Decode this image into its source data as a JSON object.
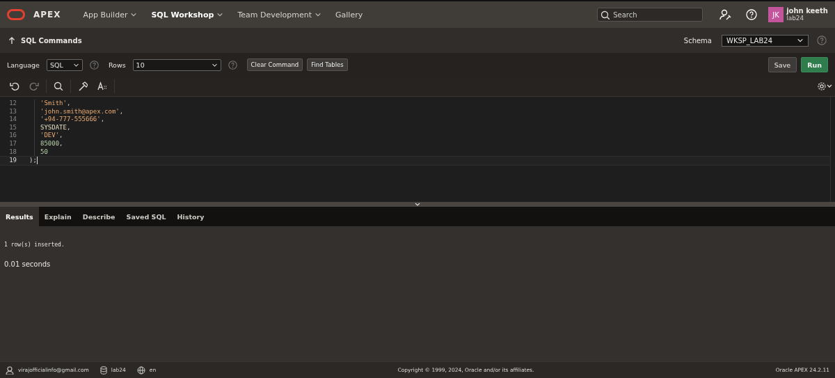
{
  "header": {
    "logo_text": "APEX",
    "nav": [
      {
        "label": "App Builder",
        "selected": false,
        "has_menu": true
      },
      {
        "label": "SQL Workshop",
        "selected": true,
        "has_menu": true
      },
      {
        "label": "Team Development",
        "selected": false,
        "has_menu": true
      },
      {
        "label": "Gallery",
        "selected": false,
        "has_menu": false
      }
    ],
    "search": {
      "placeholder": "Search"
    },
    "user": {
      "initials": "JK",
      "name": "john keeth",
      "workspace": "lab24"
    }
  },
  "page": {
    "title": "SQL Commands",
    "schema_label": "Schema",
    "schema_value": "WKSP_LAB24"
  },
  "options": {
    "language_label": "Language",
    "language_value": "SQL",
    "rows_label": "Rows",
    "rows_value": "10",
    "buttons": [
      "Clear Command",
      "Find Tables"
    ],
    "save": "Save",
    "run": "Run"
  },
  "editor": {
    "lines": [
      {
        "number": "12",
        "tokens": [
          {
            "kind": "string",
            "text": "'Smith'"
          },
          {
            "kind": "punct",
            "text": ","
          }
        ]
      },
      {
        "number": "13",
        "tokens": [
          {
            "kind": "string",
            "text": "'john.smith@apex.com'"
          },
          {
            "kind": "punct",
            "text": ","
          }
        ]
      },
      {
        "number": "14",
        "tokens": [
          {
            "kind": "string",
            "text": "'+94-777-555666'"
          },
          {
            "kind": "punct",
            "text": ","
          }
        ]
      },
      {
        "number": "15",
        "tokens": [
          {
            "kind": "keyword",
            "text": "SYSDATE"
          },
          {
            "kind": "punct",
            "text": ","
          }
        ]
      },
      {
        "number": "16",
        "tokens": [
          {
            "kind": "string",
            "text": "'DEV'"
          },
          {
            "kind": "punct",
            "text": ","
          }
        ]
      },
      {
        "number": "17",
        "tokens": [
          {
            "kind": "number",
            "text": "85000"
          },
          {
            "kind": "punct",
            "text": ","
          }
        ]
      },
      {
        "number": "18",
        "tokens": [
          {
            "kind": "number",
            "text": "50"
          }
        ]
      },
      {
        "number": "19",
        "tokens": [
          {
            "kind": "punct",
            "text": ");"
          }
        ]
      }
    ]
  },
  "result_tabs": [
    {
      "label": "Results",
      "selected": true
    },
    {
      "label": "Explain",
      "selected": false
    },
    {
      "label": "Describe",
      "selected": false
    },
    {
      "label": "Saved SQL",
      "selected": false
    },
    {
      "label": "History",
      "selected": false
    }
  ],
  "results": {
    "message": "1 row(s) inserted.",
    "timing": "0.01 seconds"
  },
  "footer": {
    "email": "virajofficialinfo@gmail.com",
    "workspace": "lab24",
    "language": "en",
    "copyright": "Copyright © 1999, 2024, Oracle and/or its affiliates.",
    "version": "Oracle APEX 24.2.11"
  }
}
